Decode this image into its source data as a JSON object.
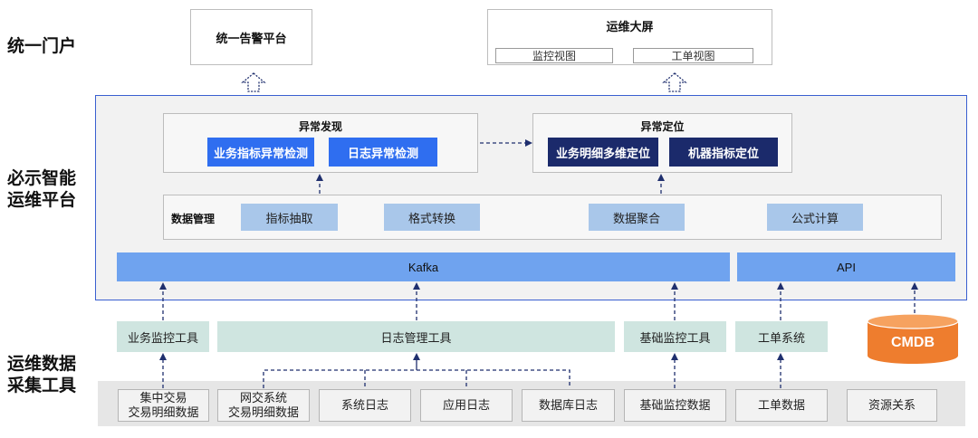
{
  "layers": {
    "portal": "统一门户",
    "platform_line1": "必示智能",
    "platform_line2": "运维平台",
    "collect_line1": "运维数据",
    "collect_line2": "采集工具"
  },
  "portal": {
    "alarm_platform": "统一告警平台",
    "big_screen": {
      "title": "运维大屏",
      "views": [
        "监控视图",
        "工单视图"
      ]
    }
  },
  "platform": {
    "anomaly_detection": {
      "title": "异常发现",
      "items": [
        "业务指标异常检测",
        "日志异常检测"
      ]
    },
    "anomaly_location": {
      "title": "异常定位",
      "items": [
        "业务明细多维定位",
        "机器指标定位"
      ]
    },
    "data_management": {
      "label": "数据管理",
      "items": [
        "指标抽取",
        "格式转换",
        "数据聚合",
        "公式计算"
      ]
    },
    "kafka": "Kafka",
    "api": "API"
  },
  "tools": [
    "业务监控工具",
    "日志管理工具",
    "基础监控工具",
    "工单系统"
  ],
  "cmdb": "CMDB",
  "sources": [
    {
      "line1": "集中交易",
      "line2": "交易明细数据"
    },
    {
      "line1": "网交系统",
      "line2": "交易明细数据"
    },
    {
      "line1": "系统日志",
      "line2": ""
    },
    {
      "line1": "应用日志",
      "line2": ""
    },
    {
      "line1": "数据库日志",
      "line2": ""
    },
    {
      "line1": "基础监控数据",
      "line2": ""
    },
    {
      "line1": "工单数据",
      "line2": ""
    },
    {
      "line1": "资源关系",
      "line2": ""
    }
  ],
  "colors": {
    "platform_border": "#3a5fd0",
    "detect_blue": "#2f6ef0",
    "locate_navy": "#1b2a6b",
    "data_blue": "#a9c7ea",
    "bar_blue": "#6fa3ef",
    "tool_mint": "#cfe5e0",
    "cmdb_orange": "#ee7d2e",
    "arrow_navy": "#1f2f6e"
  }
}
